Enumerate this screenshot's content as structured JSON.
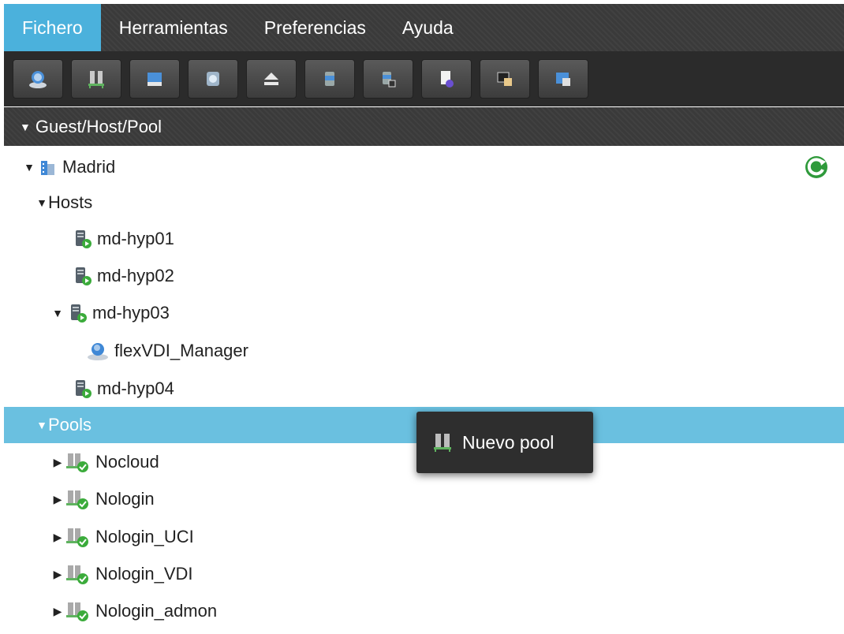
{
  "menubar": {
    "items": [
      {
        "label": "Fichero"
      },
      {
        "label": "Herramientas"
      },
      {
        "label": "Preferencias"
      },
      {
        "label": "Ayuda"
      }
    ]
  },
  "toolbar": {
    "buttons": [
      {
        "icon": "desktop-user-icon"
      },
      {
        "icon": "pool-icon"
      },
      {
        "icon": "display-icon"
      },
      {
        "icon": "disk-image-icon"
      },
      {
        "icon": "eject-icon"
      },
      {
        "icon": "storage-icon"
      },
      {
        "icon": "storage-link-icon"
      },
      {
        "icon": "document-icon"
      },
      {
        "icon": "terminal-icon"
      },
      {
        "icon": "window-icon"
      }
    ]
  },
  "section": {
    "title": "Guest/Host/Pool"
  },
  "tree": {
    "site": {
      "label": "Madrid"
    },
    "hosts_group": {
      "label": "Hosts"
    },
    "hosts": [
      {
        "label": "md-hyp01"
      },
      {
        "label": "md-hyp02"
      },
      {
        "label": "md-hyp03"
      },
      {
        "label": "md-hyp04"
      }
    ],
    "guest": {
      "label": "flexVDI_Manager"
    },
    "pools_group": {
      "label": "Pools"
    },
    "pools": [
      {
        "label": "Nocloud"
      },
      {
        "label": "Nologin"
      },
      {
        "label": "Nologin_UCI"
      },
      {
        "label": "Nologin_VDI"
      },
      {
        "label": "Nologin_admon"
      }
    ]
  },
  "context_menu": {
    "label": "Nuevo pool"
  },
  "colors": {
    "accent": "#4bb1dc",
    "selected_row": "#6ac0e0",
    "toolbar_bg": "#2b2b2b",
    "menubar_bg": "#3a3a3a"
  }
}
